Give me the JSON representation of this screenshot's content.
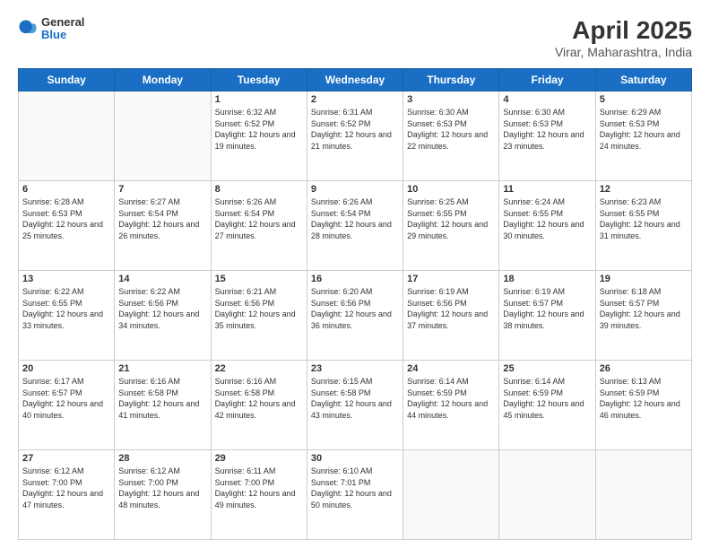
{
  "header": {
    "logo": {
      "general": "General",
      "blue": "Blue"
    },
    "title": "April 2025",
    "subtitle": "Virar, Maharashtra, India"
  },
  "weekdays": [
    "Sunday",
    "Monday",
    "Tuesday",
    "Wednesday",
    "Thursday",
    "Friday",
    "Saturday"
  ],
  "weeks": [
    [
      null,
      null,
      {
        "day": 1,
        "sunrise": "6:32 AM",
        "sunset": "6:52 PM",
        "daylight": "12 hours and 19 minutes."
      },
      {
        "day": 2,
        "sunrise": "6:31 AM",
        "sunset": "6:52 PM",
        "daylight": "12 hours and 21 minutes."
      },
      {
        "day": 3,
        "sunrise": "6:30 AM",
        "sunset": "6:53 PM",
        "daylight": "12 hours and 22 minutes."
      },
      {
        "day": 4,
        "sunrise": "6:30 AM",
        "sunset": "6:53 PM",
        "daylight": "12 hours and 23 minutes."
      },
      {
        "day": 5,
        "sunrise": "6:29 AM",
        "sunset": "6:53 PM",
        "daylight": "12 hours and 24 minutes."
      }
    ],
    [
      {
        "day": 6,
        "sunrise": "6:28 AM",
        "sunset": "6:53 PM",
        "daylight": "12 hours and 25 minutes."
      },
      {
        "day": 7,
        "sunrise": "6:27 AM",
        "sunset": "6:54 PM",
        "daylight": "12 hours and 26 minutes."
      },
      {
        "day": 8,
        "sunrise": "6:26 AM",
        "sunset": "6:54 PM",
        "daylight": "12 hours and 27 minutes."
      },
      {
        "day": 9,
        "sunrise": "6:26 AM",
        "sunset": "6:54 PM",
        "daylight": "12 hours and 28 minutes."
      },
      {
        "day": 10,
        "sunrise": "6:25 AM",
        "sunset": "6:55 PM",
        "daylight": "12 hours and 29 minutes."
      },
      {
        "day": 11,
        "sunrise": "6:24 AM",
        "sunset": "6:55 PM",
        "daylight": "12 hours and 30 minutes."
      },
      {
        "day": 12,
        "sunrise": "6:23 AM",
        "sunset": "6:55 PM",
        "daylight": "12 hours and 31 minutes."
      }
    ],
    [
      {
        "day": 13,
        "sunrise": "6:22 AM",
        "sunset": "6:55 PM",
        "daylight": "12 hours and 33 minutes."
      },
      {
        "day": 14,
        "sunrise": "6:22 AM",
        "sunset": "6:56 PM",
        "daylight": "12 hours and 34 minutes."
      },
      {
        "day": 15,
        "sunrise": "6:21 AM",
        "sunset": "6:56 PM",
        "daylight": "12 hours and 35 minutes."
      },
      {
        "day": 16,
        "sunrise": "6:20 AM",
        "sunset": "6:56 PM",
        "daylight": "12 hours and 36 minutes."
      },
      {
        "day": 17,
        "sunrise": "6:19 AM",
        "sunset": "6:56 PM",
        "daylight": "12 hours and 37 minutes."
      },
      {
        "day": 18,
        "sunrise": "6:19 AM",
        "sunset": "6:57 PM",
        "daylight": "12 hours and 38 minutes."
      },
      {
        "day": 19,
        "sunrise": "6:18 AM",
        "sunset": "6:57 PM",
        "daylight": "12 hours and 39 minutes."
      }
    ],
    [
      {
        "day": 20,
        "sunrise": "6:17 AM",
        "sunset": "6:57 PM",
        "daylight": "12 hours and 40 minutes."
      },
      {
        "day": 21,
        "sunrise": "6:16 AM",
        "sunset": "6:58 PM",
        "daylight": "12 hours and 41 minutes."
      },
      {
        "day": 22,
        "sunrise": "6:16 AM",
        "sunset": "6:58 PM",
        "daylight": "12 hours and 42 minutes."
      },
      {
        "day": 23,
        "sunrise": "6:15 AM",
        "sunset": "6:58 PM",
        "daylight": "12 hours and 43 minutes."
      },
      {
        "day": 24,
        "sunrise": "6:14 AM",
        "sunset": "6:59 PM",
        "daylight": "12 hours and 44 minutes."
      },
      {
        "day": 25,
        "sunrise": "6:14 AM",
        "sunset": "6:59 PM",
        "daylight": "12 hours and 45 minutes."
      },
      {
        "day": 26,
        "sunrise": "6:13 AM",
        "sunset": "6:59 PM",
        "daylight": "12 hours and 46 minutes."
      }
    ],
    [
      {
        "day": 27,
        "sunrise": "6:12 AM",
        "sunset": "7:00 PM",
        "daylight": "12 hours and 47 minutes."
      },
      {
        "day": 28,
        "sunrise": "6:12 AM",
        "sunset": "7:00 PM",
        "daylight": "12 hours and 48 minutes."
      },
      {
        "day": 29,
        "sunrise": "6:11 AM",
        "sunset": "7:00 PM",
        "daylight": "12 hours and 49 minutes."
      },
      {
        "day": 30,
        "sunrise": "6:10 AM",
        "sunset": "7:01 PM",
        "daylight": "12 hours and 50 minutes."
      },
      null,
      null,
      null
    ]
  ],
  "labels": {
    "sunrise": "Sunrise:",
    "sunset": "Sunset:",
    "daylight": "Daylight:"
  }
}
